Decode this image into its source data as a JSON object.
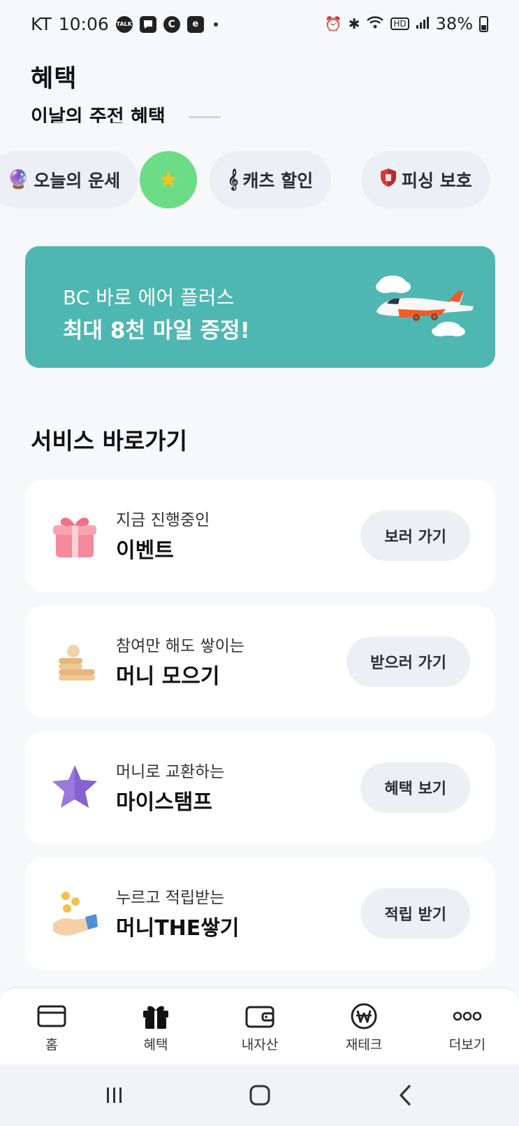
{
  "status_bar": {
    "carrier": "KT",
    "time": "10:06",
    "battery": "38%",
    "notification_icons": [
      "talk-icon",
      "chat-bubble-icon",
      "c-circle-icon",
      "app-square-icon"
    ],
    "system_icons": [
      "alarm-icon",
      "bluetooth-icon",
      "wifi-icon",
      "hd-icon",
      "signal-icon",
      "battery-icon"
    ]
  },
  "header": {
    "title": "혜택",
    "subtitle": "이날의 주전 혜택"
  },
  "chips": [
    {
      "label": "오늘의 운세",
      "icon": "crystal-ball-icon"
    },
    {
      "label": "",
      "icon": "star-icon"
    },
    {
      "label": "캐츠 할인",
      "icon": "music-note-icon"
    },
    {
      "label": "피싱 보호",
      "icon": "shield-icon"
    }
  ],
  "banner": {
    "line1": "BC 바로 에어 플러스",
    "line2": "최대 8천 마일 증정!",
    "color": "#4fb7b1",
    "icon": "airplane-icon"
  },
  "services": {
    "title": "서비스 바로가기",
    "items": [
      {
        "subtitle": "지금 진행중인",
        "title": "이벤트",
        "button": "보러 가기",
        "icon": "gift-icon"
      },
      {
        "subtitle": "참여만 해도 쌓이는",
        "title": "머니 모으기",
        "button": "받으러 가기",
        "icon": "coins-icon"
      },
      {
        "subtitle": "머니로 교환하는",
        "title": "마이스탬프",
        "button": "혜택 보기",
        "icon": "purple-star-icon"
      },
      {
        "subtitle": "누르고 적립받는",
        "title": "머니THE쌓기",
        "button": "적립 받기",
        "icon": "hand-coins-icon"
      }
    ]
  },
  "bottom_nav": [
    {
      "label": "홈",
      "icon": "card-icon"
    },
    {
      "label": "혜택",
      "icon": "gift-box-icon"
    },
    {
      "label": "내자산",
      "icon": "wallet-icon"
    },
    {
      "label": "재테크",
      "icon": "won-icon"
    },
    {
      "label": "더보기",
      "icon": "more-dots-icon"
    }
  ],
  "system_nav": [
    "recent-apps-icon",
    "home-icon",
    "back-icon"
  ]
}
